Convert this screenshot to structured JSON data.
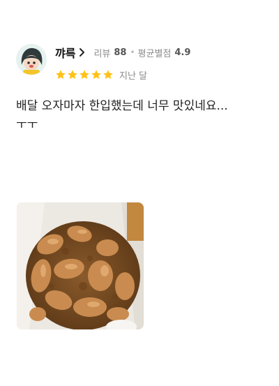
{
  "reviewer": {
    "name": "꺄륵",
    "review_count_label": "리뷰",
    "review_count": "88",
    "avg_rating_label": "평균별점",
    "avg_rating": "4.9",
    "separator": "•"
  },
  "review": {
    "stars": 5,
    "date": "지난 달",
    "text": "배달 오자마자 한입했는데 너무 맛있네요...\nㅜㅜ"
  },
  "colors": {
    "star": "#ffc21a",
    "text": "#222222",
    "meta": "#8a8a8a"
  },
  "icons": {
    "avatar": "character-avatar",
    "chevron": "chevron-right-icon",
    "star": "star-icon"
  }
}
